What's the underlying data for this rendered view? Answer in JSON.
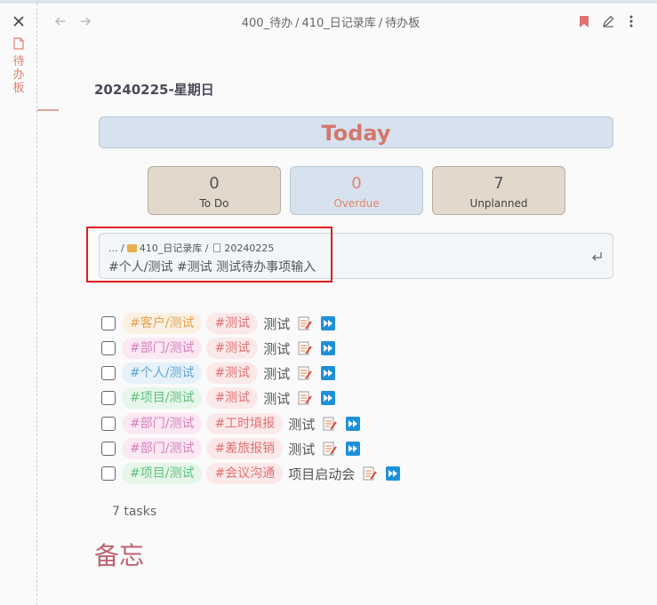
{
  "sidebar": {
    "note_title": "待办板"
  },
  "header": {
    "breadcrumb": [
      "400_待办",
      "410_日记录库",
      "待办板"
    ]
  },
  "page": {
    "date_title": "20240225-星期日",
    "today_label": "Today",
    "stats": [
      {
        "value": "0",
        "label": "To Do"
      },
      {
        "value": "0",
        "label": "Overdue"
      },
      {
        "value": "7",
        "label": "Unplanned"
      }
    ],
    "input": {
      "path_prefix": "... /",
      "path_folder": "410_日记录库 /",
      "path_file": "20240225",
      "text": "#个人/测试 #测试 测试待办事项输入"
    },
    "tasks": [
      {
        "tag1": "#客户/测试",
        "tag2": "#测试",
        "text": "测试"
      },
      {
        "tag1": "#部门/测试",
        "tag2": "#测试",
        "text": "测试"
      },
      {
        "tag1": "#个人/测试",
        "tag2": "#测试",
        "text": "测试"
      },
      {
        "tag1": "#项目/测试",
        "tag2": "#测试",
        "text": "测试"
      },
      {
        "tag1": "#部门/测试",
        "tag2": "#工时填报",
        "text": "测试"
      },
      {
        "tag1": "#部门/测试",
        "tag2": "#差旅报销",
        "text": "测试"
      },
      {
        "tag1": "#项目/测试",
        "tag2": "#会议沟通",
        "text": "项目启动会"
      }
    ],
    "task_count": "7 tasks",
    "memo_heading": "备忘"
  },
  "colors": {
    "accent": "#d4776e",
    "highlight_box": "#e01d1d",
    "today_bg": "#d6e3ee",
    "stat_bg": "#e2d8cc"
  },
  "icons": [
    "close-icon",
    "file-icon",
    "back-arrow-icon",
    "forward-arrow-icon",
    "bookmark-icon",
    "edit-icon",
    "more-icon",
    "enter-icon",
    "note-icon",
    "play-icon"
  ]
}
